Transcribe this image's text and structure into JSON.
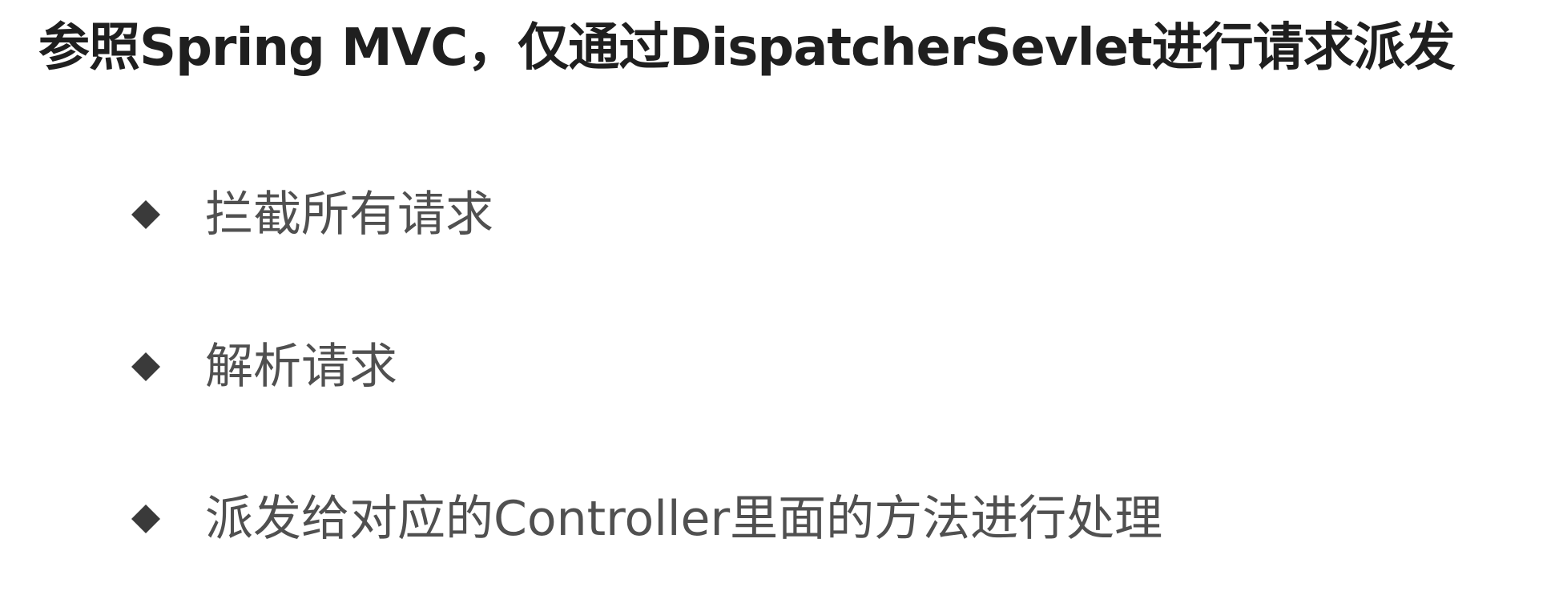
{
  "slide": {
    "title": "参照Spring MVC，仅通过DispatcherSevlet进行请求派发",
    "bullets": [
      {
        "text": "拦截所有请求",
        "icon": "diamond-bullet-icon"
      },
      {
        "text": "解析请求",
        "icon": "diamond-bullet-icon"
      },
      {
        "text": "派发给对应的Controller里面的方法进行处理",
        "icon": "diamond-bullet-icon"
      }
    ]
  },
  "colors": {
    "title": "#1f1f1f",
    "body_text": "#505050",
    "bullet_marker": "#3a3a3a",
    "background": "#ffffff"
  }
}
